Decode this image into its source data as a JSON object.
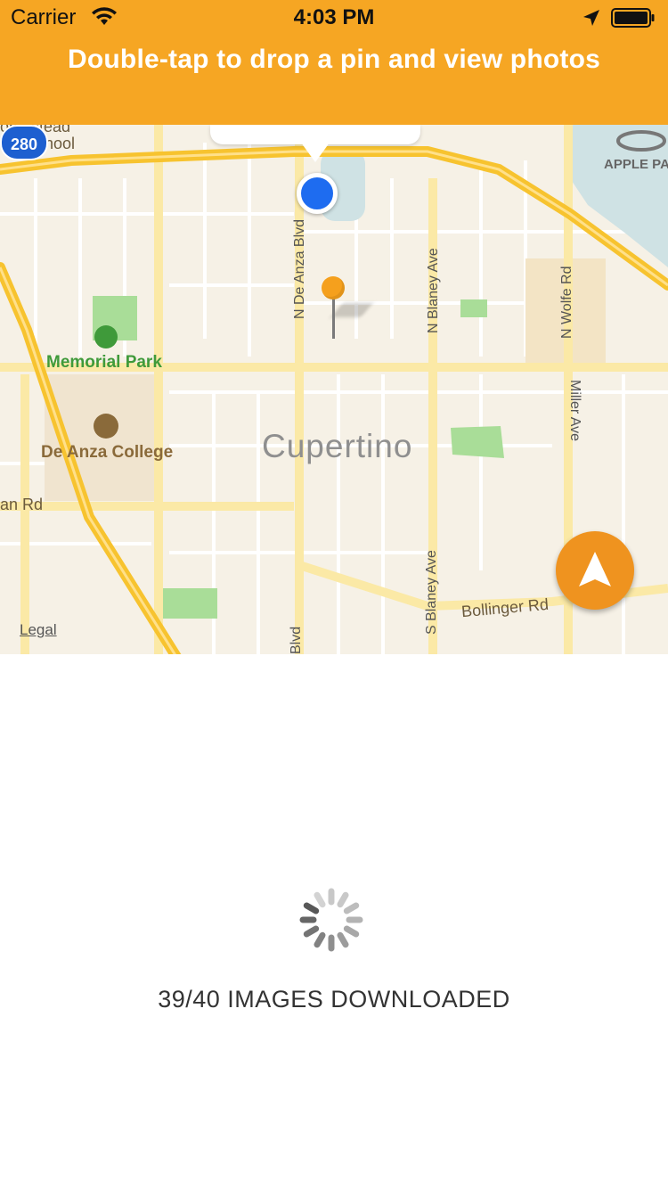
{
  "status_bar": {
    "carrier": "Carrier",
    "time": "4:03 PM"
  },
  "header": {
    "title": "Double-tap to drop a pin and view photos",
    "color": "#f6a623"
  },
  "map": {
    "city": "Cupertino",
    "labels": {
      "school_line1": "omestead",
      "school_line2": "igh School",
      "park": "Memorial Park",
      "college": "De Anza College",
      "apple": "APPLE PA",
      "road_left": "an Rd",
      "bollinger": "Bollinger Rd",
      "de_anza_n": "N De Anza Blvd",
      "de_anza_s": "Blvd",
      "blaney_n": "N Blaney Ave",
      "blaney_s": "S Blaney Ave",
      "wolfe": "N Wolfe Rd",
      "miller": "Miller Ave",
      "highway": "280"
    },
    "legal": "Legal"
  },
  "progress": {
    "text": "39/40 IMAGES DOWNLOADED",
    "downloaded": 39,
    "total": 40
  },
  "icons": [
    "wifi-icon",
    "location-arrow-icon",
    "battery-icon",
    "user-location-icon",
    "map-pin-icon",
    "highway-shield-icon",
    "navigation-icon",
    "spinner-icon"
  ]
}
